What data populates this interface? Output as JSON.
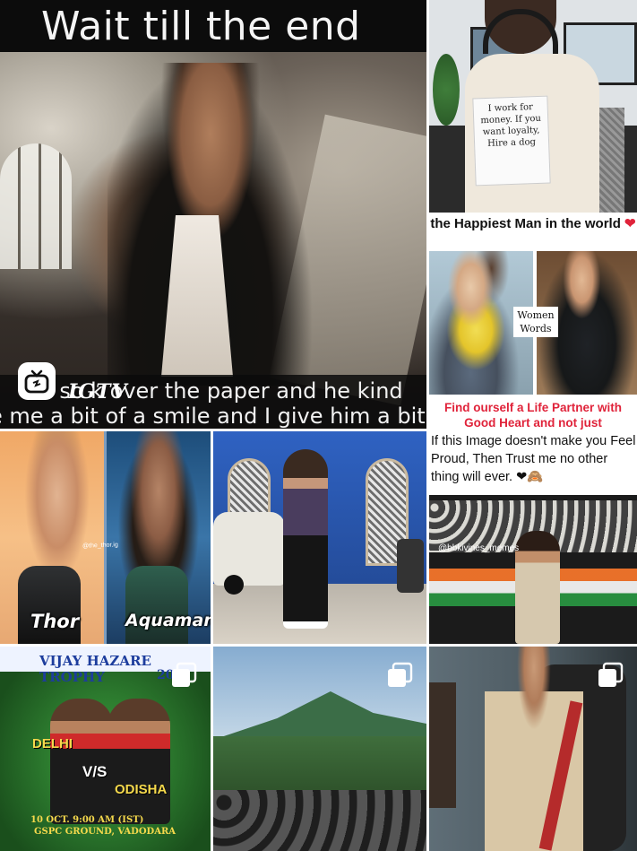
{
  "igtv_post": {
    "title_overlay": "Wait till the end",
    "subtitle_line1": "o    so   k over the paper and he kind",
    "subtitle_line2": "e me a bit of a smile and I give him a bit of a",
    "badge_label": "IGTV",
    "badge_icon": "igtv-icon"
  },
  "office_post": {
    "note_text": "I work for money. If you want loyalty, Hire a dog"
  },
  "couple_post": {
    "headline": "the Happiest Man in the world",
    "headline_heart": "❤",
    "photo_label": "Women Words",
    "pink_text": "Find ourself a Life Partner with Good Heart and not just",
    "body_text": "If this Image doesn't make you Feel Proud, Then Trust me no other thing will ever.",
    "body_emoji": "❤🙈",
    "handle": "@bbkivines_memes"
  },
  "thor_post": {
    "left_name": "Thor",
    "right_name": "Aquaman",
    "handle": "@the_thor.ig"
  },
  "cricket_post": {
    "trophy_title": "VIJAY HAZARE TROPHY",
    "year": "201",
    "team1": "DELHI",
    "versus": "V/S",
    "team2": "ODISHA",
    "date": "10 OCT. 9:00 AM (IST)",
    "venue": "GSPC GROUND, VADODARA",
    "badge_icon": "carousel-icon"
  },
  "mountain_post": {
    "badge_icon": "carousel-icon"
  },
  "saree_post": {
    "badge_icon": "carousel-icon"
  },
  "street_post": {},
  "colors": {
    "heart": "#e0233a",
    "pink_text": "#e0233a",
    "background": "#ffffff"
  }
}
